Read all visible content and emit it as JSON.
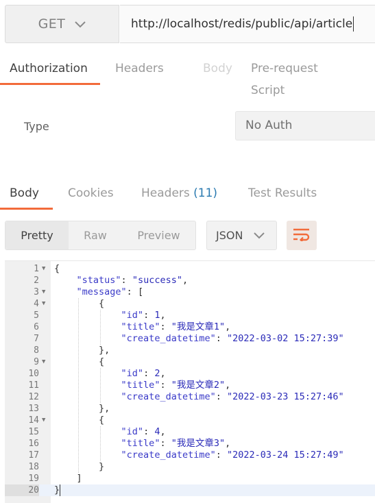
{
  "request": {
    "method": "GET",
    "url": "http://localhost/redis/public/api/article"
  },
  "request_tabs": [
    {
      "label": "Authorization",
      "state": "active"
    },
    {
      "label": "Headers",
      "state": "normal"
    },
    {
      "label": "Body",
      "state": "disabled"
    },
    {
      "label": "Pre-request Script",
      "state": "normal"
    }
  ],
  "auth": {
    "type_label": "Type",
    "type_value": "No Auth"
  },
  "response_tabs": [
    {
      "label": "Body",
      "state": "active"
    },
    {
      "label": "Cookies",
      "state": "normal"
    },
    {
      "label": "Headers",
      "count": "(11)",
      "state": "normal"
    },
    {
      "label": "Test Results",
      "state": "normal"
    }
  ],
  "view_modes": [
    "Pretty",
    "Raw",
    "Preview"
  ],
  "active_view": "Pretty",
  "format": "JSON",
  "icons": {
    "method_dropdown": "chevron-down-icon",
    "format_dropdown": "chevron-down-icon",
    "wrap": "wrap-lines-icon",
    "fold": "fold-arrow-icon"
  },
  "colors": {
    "accent": "#f26b3a",
    "badge": "#2a7ab0",
    "json_value": "#2a2ab8"
  },
  "code_lines": [
    {
      "n": "1",
      "fold": true,
      "text": "{"
    },
    {
      "n": "2",
      "fold": false,
      "text": "    \"status\": \"success\","
    },
    {
      "n": "3",
      "fold": true,
      "text": "    \"message\": ["
    },
    {
      "n": "4",
      "fold": true,
      "text": "        {"
    },
    {
      "n": "5",
      "fold": false,
      "text": "            \"id\": 1,"
    },
    {
      "n": "6",
      "fold": false,
      "text": "            \"title\": \"我是文章1\","
    },
    {
      "n": "7",
      "fold": false,
      "text": "            \"create_datetime\": \"2022-03-02 15:27:39\""
    },
    {
      "n": "8",
      "fold": false,
      "text": "        },"
    },
    {
      "n": "9",
      "fold": true,
      "text": "        {"
    },
    {
      "n": "10",
      "fold": false,
      "text": "            \"id\": 2,"
    },
    {
      "n": "11",
      "fold": false,
      "text": "            \"title\": \"我是文章2\","
    },
    {
      "n": "12",
      "fold": false,
      "text": "            \"create_datetime\": \"2022-03-23 15:27:46\""
    },
    {
      "n": "13",
      "fold": false,
      "text": "        },"
    },
    {
      "n": "14",
      "fold": true,
      "text": "        {"
    },
    {
      "n": "15",
      "fold": false,
      "text": "            \"id\": 4,"
    },
    {
      "n": "16",
      "fold": false,
      "text": "            \"title\": \"我是文章3\","
    },
    {
      "n": "17",
      "fold": false,
      "text": "            \"create_datetime\": \"2022-03-24 15:27:49\""
    },
    {
      "n": "18",
      "fold": false,
      "text": "        }"
    },
    {
      "n": "19",
      "fold": false,
      "text": "    ]"
    },
    {
      "n": "20",
      "fold": false,
      "text": "}",
      "current": true
    }
  ]
}
